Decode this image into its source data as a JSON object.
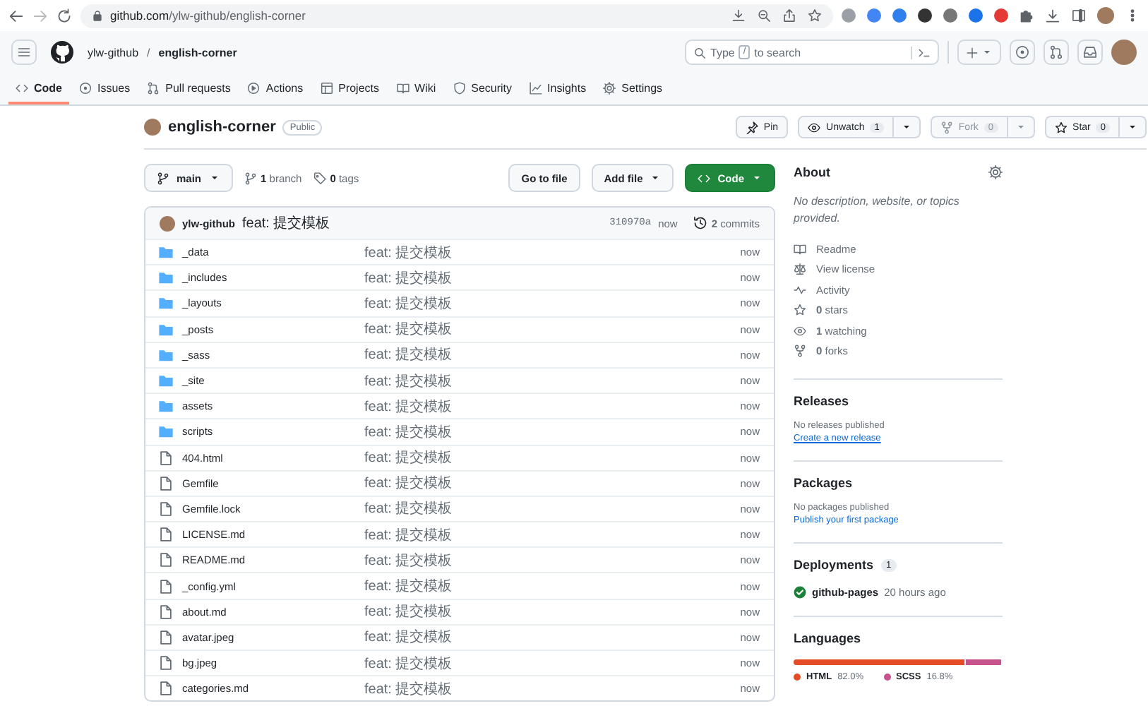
{
  "browser": {
    "url_host": "github.com",
    "url_path": "/ylw-github/english-corner"
  },
  "header": {
    "owner": "ylw-github",
    "separator": "/",
    "repo": "english-corner",
    "search": {
      "before": "Type",
      "key": "/",
      "after": "to search"
    }
  },
  "nav_tabs": [
    {
      "label": "Code",
      "selected": true
    },
    {
      "label": "Issues",
      "selected": false
    },
    {
      "label": "Pull requests",
      "selected": false
    },
    {
      "label": "Actions",
      "selected": false
    },
    {
      "label": "Projects",
      "selected": false
    },
    {
      "label": "Wiki",
      "selected": false
    },
    {
      "label": "Security",
      "selected": false
    },
    {
      "label": "Insights",
      "selected": false
    },
    {
      "label": "Settings",
      "selected": false
    }
  ],
  "repo": {
    "name": "english-corner",
    "visibility": "Public",
    "actions": [
      {
        "kind": "plain",
        "label": "Pin",
        "disabled": false
      },
      {
        "kind": "split",
        "label": "Unwatch",
        "count": "1",
        "disabled": false
      },
      {
        "kind": "split",
        "label": "Fork",
        "count": "0",
        "disabled": true
      },
      {
        "kind": "split",
        "label": "Star",
        "count": "0",
        "disabled": false
      }
    ]
  },
  "branch_bar": {
    "branch": "main",
    "branches": "**1** branch",
    "tags": "**0** tags",
    "buttons": [
      {
        "kind": "plain",
        "label": "Go to file"
      },
      {
        "kind": "menu",
        "label": "Add file"
      },
      {
        "kind": "primary",
        "label": "Code"
      }
    ]
  },
  "latest_commit": {
    "author": "ylw-github",
    "message": "feat: 提交模板",
    "hash": "310970a",
    "time": "now",
    "commits": "**2** commits"
  },
  "files": [
    {
      "kind": "dir",
      "name": "_data",
      "message": "feat: 提交模板",
      "time": "now"
    },
    {
      "kind": "dir",
      "name": "_includes",
      "message": "feat: 提交模板",
      "time": "now"
    },
    {
      "kind": "dir",
      "name": "_layouts",
      "message": "feat: 提交模板",
      "time": "now"
    },
    {
      "kind": "dir",
      "name": "_posts",
      "message": "feat: 提交模板",
      "time": "now"
    },
    {
      "kind": "dir",
      "name": "_sass",
      "message": "feat: 提交模板",
      "time": "now"
    },
    {
      "kind": "dir",
      "name": "_site",
      "message": "feat: 提交模板",
      "time": "now"
    },
    {
      "kind": "dir",
      "name": "assets",
      "message": "feat: 提交模板",
      "time": "now"
    },
    {
      "kind": "dir",
      "name": "scripts",
      "message": "feat: 提交模板",
      "time": "now"
    },
    {
      "kind": "file",
      "name": "404.html",
      "message": "feat: 提交模板",
      "time": "now"
    },
    {
      "kind": "file",
      "name": "Gemfile",
      "message": "feat: 提交模板",
      "time": "now"
    },
    {
      "kind": "file",
      "name": "Gemfile.lock",
      "message": "feat: 提交模板",
      "time": "now"
    },
    {
      "kind": "file",
      "name": "LICENSE.md",
      "message": "feat: 提交模板",
      "time": "now"
    },
    {
      "kind": "file",
      "name": "README.md",
      "message": "feat: 提交模板",
      "time": "now"
    },
    {
      "kind": "file",
      "name": "_config.yml",
      "message": "feat: 提交模板",
      "time": "now"
    },
    {
      "kind": "file",
      "name": "about.md",
      "message": "feat: 提交模板",
      "time": "now"
    },
    {
      "kind": "file",
      "name": "avatar.jpeg",
      "message": "feat: 提交模板",
      "time": "now"
    },
    {
      "kind": "file",
      "name": "bg.jpeg",
      "message": "feat: 提交模板",
      "time": "now"
    },
    {
      "kind": "file",
      "name": "categories.md",
      "message": "feat: 提交模板",
      "time": "now"
    }
  ],
  "about": {
    "title": "About",
    "description": "No description, website, or topics provided.",
    "links": [
      "Readme",
      "View license",
      "Activity",
      "**0** stars",
      "**1** watching",
      "**0** forks"
    ]
  },
  "releases": {
    "title": "Releases",
    "note": "No releases published",
    "link": "Create a new release"
  },
  "packages": {
    "title": "Packages",
    "note": "No packages published",
    "link": "Publish your first package"
  },
  "deployments": {
    "title": "Deployments",
    "count": "1",
    "items": [
      {
        "name": "github-pages",
        "time": "20 hours ago",
        "succeeded": true
      }
    ]
  },
  "languages": {
    "title": "Languages",
    "items": [
      {
        "name": "HTML",
        "percent": "82.0%",
        "color": "#e34c26",
        "level": 0.82
      },
      {
        "name": "SCSS",
        "percent": "16.8%",
        "color": "#c6538c",
        "level": 0.168
      }
    ]
  }
}
